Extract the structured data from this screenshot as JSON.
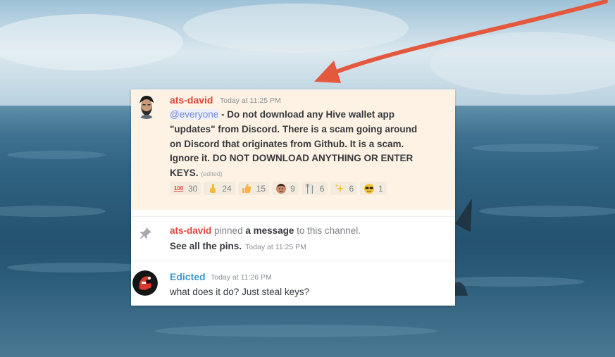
{
  "colors": {
    "mention": "#7289da",
    "author_ats": "#e0453a",
    "author_edicted": "#3b97d3",
    "highlight_bg": "#fdf2e3",
    "arrow": "#e4593d"
  },
  "messages": [
    {
      "author": "ats-david",
      "timestamp": "Today at 11:25 PM",
      "mention": "@everyone",
      "text": " - Do not download any Hive wallet app \"updates\" from Discord. There is a scam going around on Discord that originates from Github. It is a scam. Ignore it. DO NOT DOWNLOAD ANYTHING OR ENTER KEYS.",
      "edited": "(edited)",
      "reactions": [
        {
          "icon": "hundred-points-icon",
          "glyph": "💯",
          "count": "30"
        },
        {
          "icon": "raised-finger-icon",
          "glyph": "☝",
          "count": "24"
        },
        {
          "icon": "thumbs-up-icon",
          "glyph": "👍",
          "count": "15"
        },
        {
          "icon": "custom-face-icon",
          "glyph": "◉",
          "count": "9"
        },
        {
          "icon": "fork-knife-icon",
          "glyph": "🍴",
          "count": "6"
        },
        {
          "icon": "sparkles-icon",
          "glyph": "✨",
          "count": "6"
        },
        {
          "icon": "sunglasses-face-icon",
          "glyph": "😎",
          "count": "1"
        }
      ]
    },
    {
      "system": true,
      "icon": "pin-icon",
      "who": "ats-david",
      "pinned": " pinned ",
      "link": "a message",
      "rest": " to this channel.",
      "see_pins": "See all the pins.",
      "timestamp": "Today at 11:25 PM"
    },
    {
      "author": "Edicted",
      "timestamp": "Today at 11:26 PM",
      "text": "what does it do?  Just steal keys?"
    }
  ]
}
